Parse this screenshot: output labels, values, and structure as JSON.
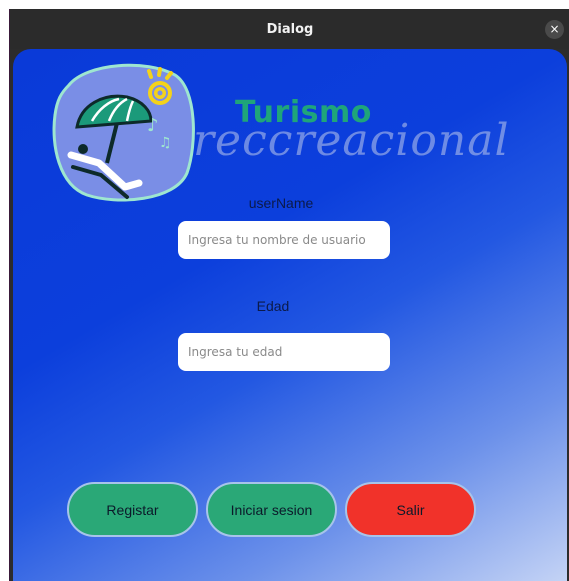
{
  "window": {
    "title": "Dialog",
    "close_glyph": "×"
  },
  "brand": {
    "line1": "Turismo",
    "line2": "reccreacional"
  },
  "logo": {
    "icon": "beach-umbrella-logo-icon"
  },
  "form": {
    "username_label": "userName",
    "username_placeholder": "Ingresa tu nombre de usuario",
    "age_label": "Edad",
    "age_placeholder": "Ingresa tu edad"
  },
  "buttons": {
    "register": "Registar",
    "login": "Iniciar sesion",
    "exit": "Salir"
  },
  "colors": {
    "background_top": "#0a3ad8",
    "background_bottom": "#c4d3f5",
    "brand_green": "#1fa57a",
    "button_green": "#2aa877",
    "button_red": "#f1322a"
  }
}
